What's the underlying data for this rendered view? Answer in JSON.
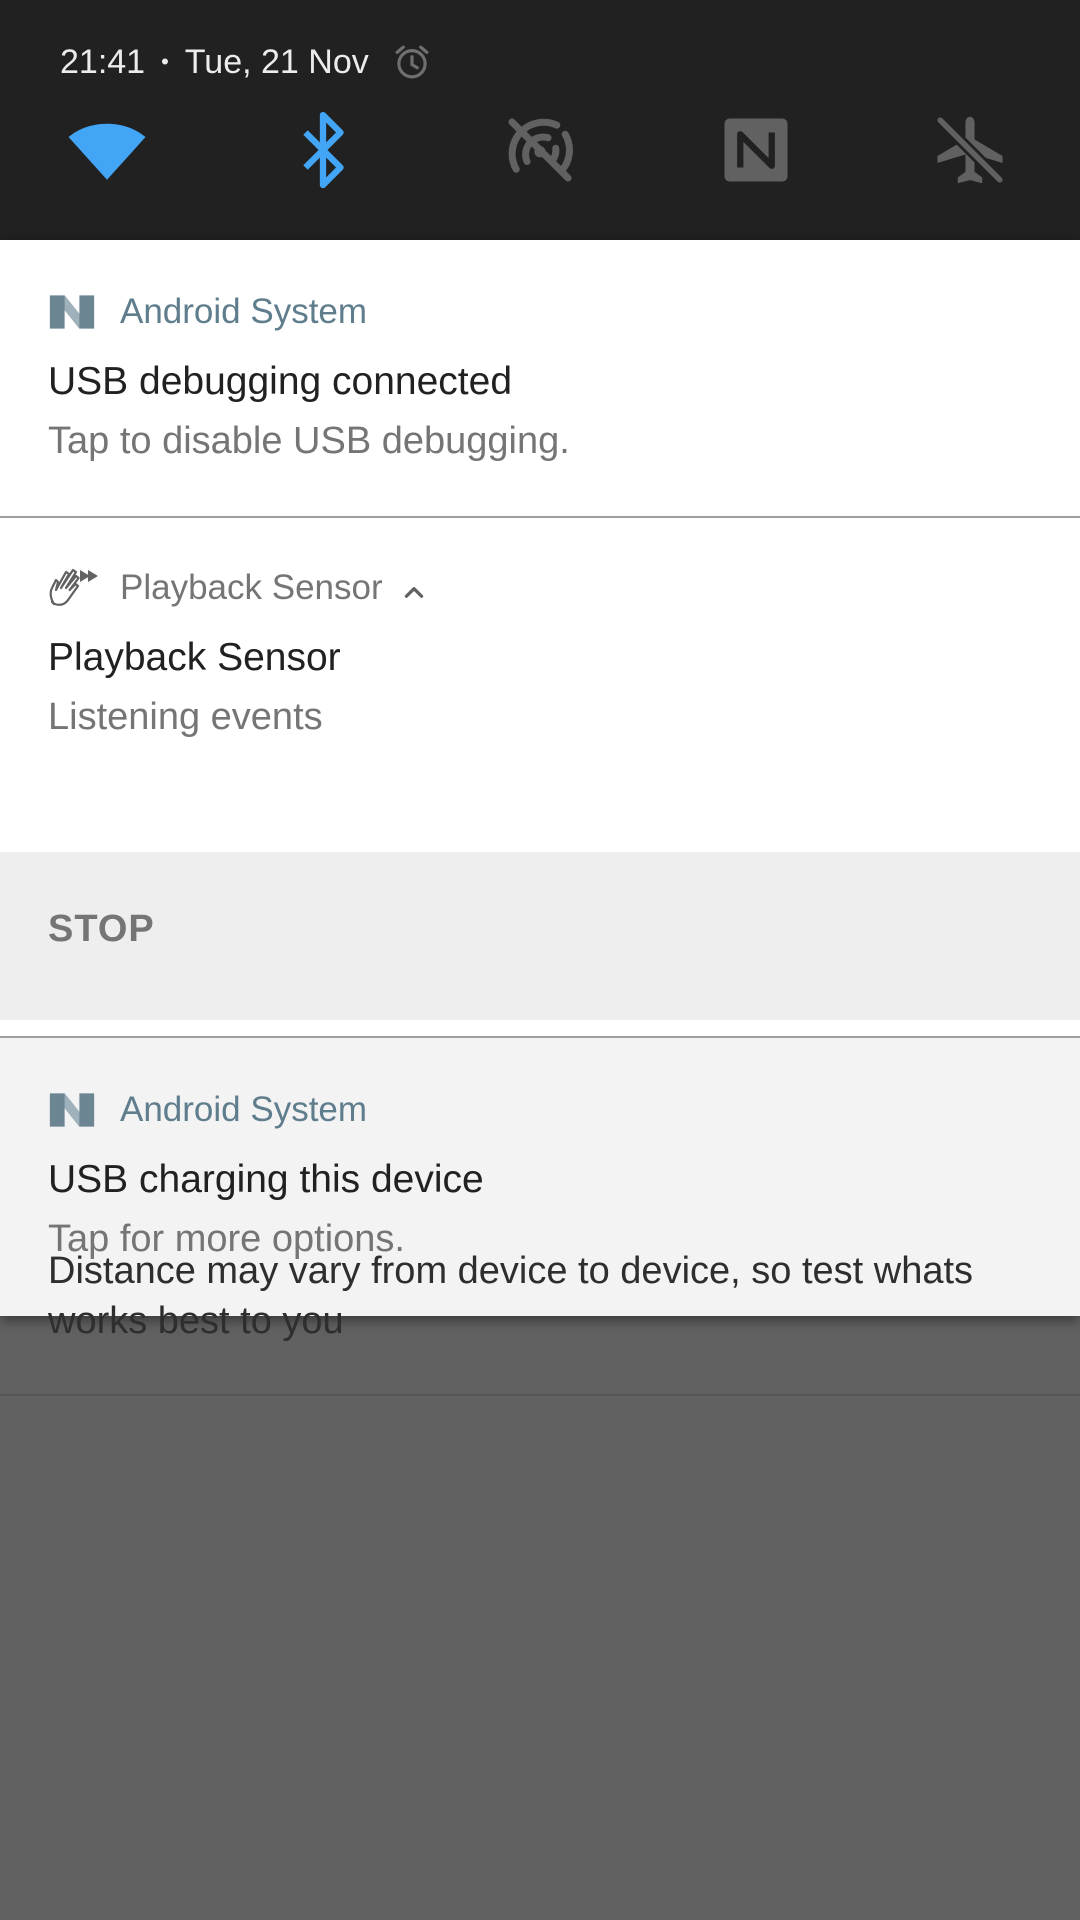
{
  "status_bar": {
    "time": "21:41",
    "separator": "•",
    "date": "Tue, 21 Nov",
    "alarm_icon": "alarm-clock-icon"
  },
  "quick_settings": [
    {
      "name": "wifi",
      "icon": "wifi-icon",
      "active": true
    },
    {
      "name": "bluetooth",
      "icon": "bluetooth-icon",
      "active": true
    },
    {
      "name": "hotspot",
      "icon": "hotspot-off-icon",
      "active": false
    },
    {
      "name": "nfc",
      "icon": "nfc-icon",
      "active": false
    },
    {
      "name": "airplane",
      "icon": "airplane-mode-off-icon",
      "active": false
    }
  ],
  "notifications": [
    {
      "app": "Android System",
      "icon": "android-n-icon",
      "title": "USB debugging connected",
      "text": "Tap to disable USB debugging."
    },
    {
      "app": "Playback Sensor",
      "icon": "waving-hand-icon",
      "expand_icon": "chevron-up-icon",
      "title": "Playback Sensor",
      "text": "Listening events",
      "action": "STOP"
    },
    {
      "app": "Android System",
      "icon": "android-n-icon",
      "title": "USB charging this device",
      "text": "Tap for more options."
    }
  ],
  "background_app": {
    "text": "Distance may vary from device to device, so test whats works best to you"
  },
  "colors": {
    "active_tile": "#42a5f5",
    "inactive_tile": "#616161",
    "header_bg": "#212121",
    "app_name": "#5f7d8c"
  }
}
